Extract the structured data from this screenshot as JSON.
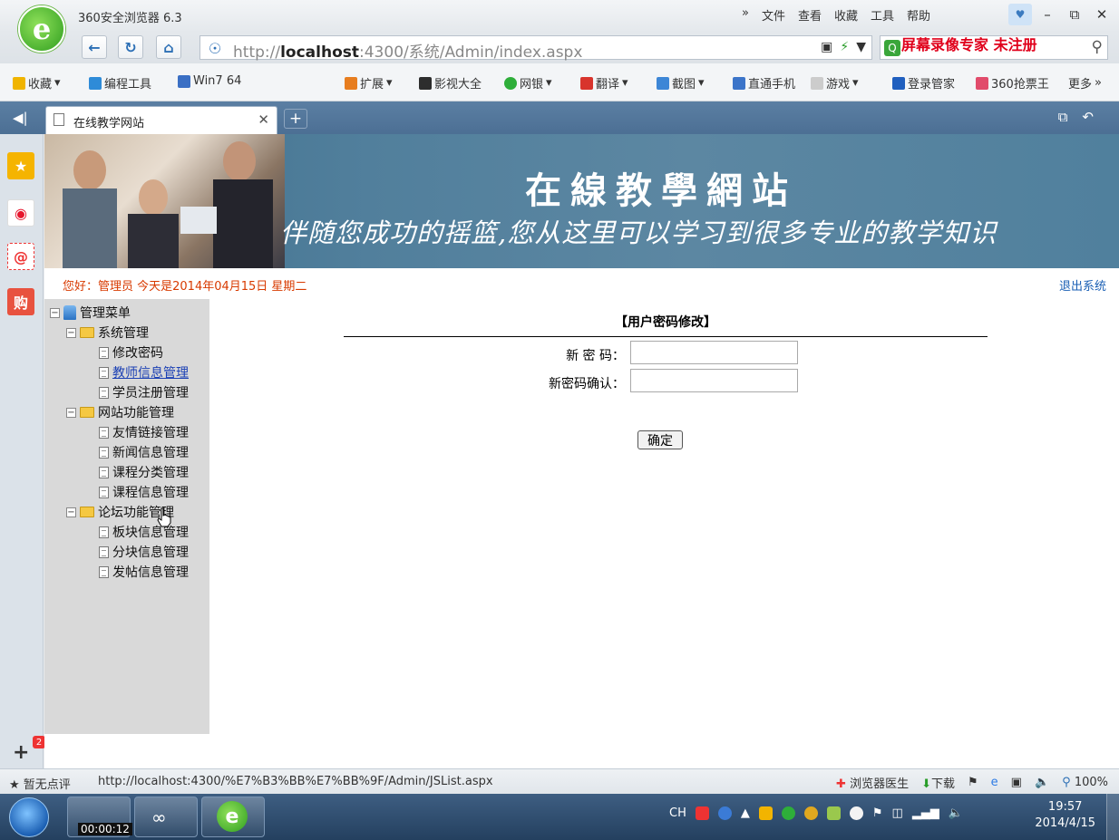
{
  "browser": {
    "app_title": "360安全浏览器 6.3",
    "top_menu": [
      "»",
      "文件",
      "查看",
      "收藏",
      "工具",
      "帮助"
    ],
    "url_host": "http://",
    "url_bold": "localhost",
    "url_rest": ":4300/系统/Admin/index.aspx",
    "search_placeholder": "",
    "watermark": "屏幕录像专家  未注册",
    "favorites": [
      "收藏",
      "编程工具",
      "Win7 64",
      "扩展",
      "影视大全",
      "网银",
      "翻译",
      "截图",
      "直通手机",
      "游戏",
      "登录管家",
      "360抢票王",
      "更多"
    ],
    "tab_title": "在线教学网站",
    "status_left": "暂无点评",
    "status_url": "http://localhost:4300/%E7%B3%BB%E7%BB%9F/Admin/JSList.aspx",
    "status_right": [
      "浏览器医生",
      "下载",
      "100%"
    ],
    "sidebar_badge": "2"
  },
  "site": {
    "banner_title": "在線教學網站",
    "banner_slogan": "伴随您成功的摇篮,您从这里可以学习到很多专业的教学知识",
    "greeting": "您好：管理员   今天是2014年04月15日  星期二",
    "logout": "退出系统"
  },
  "menu": {
    "root": "管理菜单",
    "groups": [
      {
        "label": "系统管理",
        "items": [
          "修改密码",
          "教师信息管理",
          "学员注册管理"
        ]
      },
      {
        "label": "网站功能管理",
        "items": [
          "友情链接管理",
          "新闻信息管理",
          "课程分类管理",
          "课程信息管理"
        ]
      },
      {
        "label": "论坛功能管理",
        "items": [
          "板块信息管理",
          "分块信息管理",
          "发帖信息管理"
        ]
      }
    ]
  },
  "form": {
    "title": "【用户密码修改】",
    "new_password_label": "新 密 码：",
    "confirm_password_label": "新密码确认：",
    "new_password_value": "",
    "confirm_password_value": "",
    "submit": "确定"
  },
  "taskbar": {
    "recording_time": "00:00:12",
    "tray_lang": "CH",
    "clock_time": "19:57",
    "clock_date": "2014/4/15"
  },
  "colors": {
    "banner": "#517f9c",
    "greeting": "#d83a00",
    "logout": "#1a5fb4",
    "tab_bar": "#4c6f94",
    "taskbar": "#24405f"
  }
}
